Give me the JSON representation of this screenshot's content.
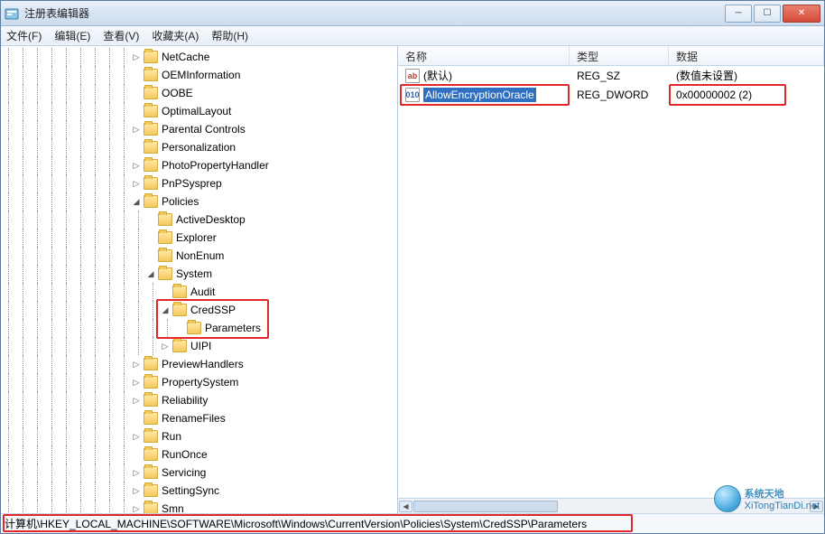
{
  "window": {
    "title": "注册表编辑器"
  },
  "menu": {
    "file": "文件(F)",
    "edit": "编辑(E)",
    "view": "查看(V)",
    "favorites": "收藏夹(A)",
    "help": "帮助(H)"
  },
  "tree": [
    {
      "depth": 9,
      "exp": "▷",
      "label": "NetCache"
    },
    {
      "depth": 9,
      "exp": "",
      "label": "OEMInformation"
    },
    {
      "depth": 9,
      "exp": "",
      "label": "OOBE"
    },
    {
      "depth": 9,
      "exp": "",
      "label": "OptimalLayout"
    },
    {
      "depth": 9,
      "exp": "▷",
      "label": "Parental Controls"
    },
    {
      "depth": 9,
      "exp": "",
      "label": "Personalization"
    },
    {
      "depth": 9,
      "exp": "▷",
      "label": "PhotoPropertyHandler"
    },
    {
      "depth": 9,
      "exp": "▷",
      "label": "PnPSysprep"
    },
    {
      "depth": 9,
      "exp": "◢",
      "label": "Policies"
    },
    {
      "depth": 10,
      "exp": "",
      "label": "ActiveDesktop"
    },
    {
      "depth": 10,
      "exp": "",
      "label": "Explorer"
    },
    {
      "depth": 10,
      "exp": "",
      "label": "NonEnum"
    },
    {
      "depth": 10,
      "exp": "◢",
      "label": "System"
    },
    {
      "depth": 11,
      "exp": "",
      "label": "Audit"
    },
    {
      "depth": 11,
      "exp": "◢",
      "label": "CredSSP"
    },
    {
      "depth": 12,
      "exp": "",
      "label": "Parameters"
    },
    {
      "depth": 11,
      "exp": "▷",
      "label": "UIPI"
    },
    {
      "depth": 9,
      "exp": "▷",
      "label": "PreviewHandlers"
    },
    {
      "depth": 9,
      "exp": "▷",
      "label": "PropertySystem"
    },
    {
      "depth": 9,
      "exp": "▷",
      "label": "Reliability"
    },
    {
      "depth": 9,
      "exp": "",
      "label": "RenameFiles"
    },
    {
      "depth": 9,
      "exp": "▷",
      "label": "Run"
    },
    {
      "depth": 9,
      "exp": "",
      "label": "RunOnce"
    },
    {
      "depth": 9,
      "exp": "▷",
      "label": "Servicing"
    },
    {
      "depth": 9,
      "exp": "▷",
      "label": "SettingSync"
    },
    {
      "depth": 9,
      "exp": "▷",
      "label": "Smn"
    }
  ],
  "list": {
    "headers": {
      "name": "名称",
      "type": "类型",
      "data": "数据"
    },
    "rows": [
      {
        "icon": "str",
        "name": "(默认)",
        "type": "REG_SZ",
        "data": "(数值未设置)",
        "selected": false
      },
      {
        "icon": "dw",
        "name": "AllowEncryptionOracle",
        "type": "REG_DWORD",
        "data": "0x00000002 (2)",
        "selected": true
      }
    ]
  },
  "statusbar": {
    "path": "计算机\\HKEY_LOCAL_MACHINE\\SOFTWARE\\Microsoft\\Windows\\CurrentVersion\\Policies\\System\\CredSSP\\Parameters"
  },
  "watermark": {
    "line1": "系统天地",
    "line2": "XiTongTianDi.net"
  }
}
